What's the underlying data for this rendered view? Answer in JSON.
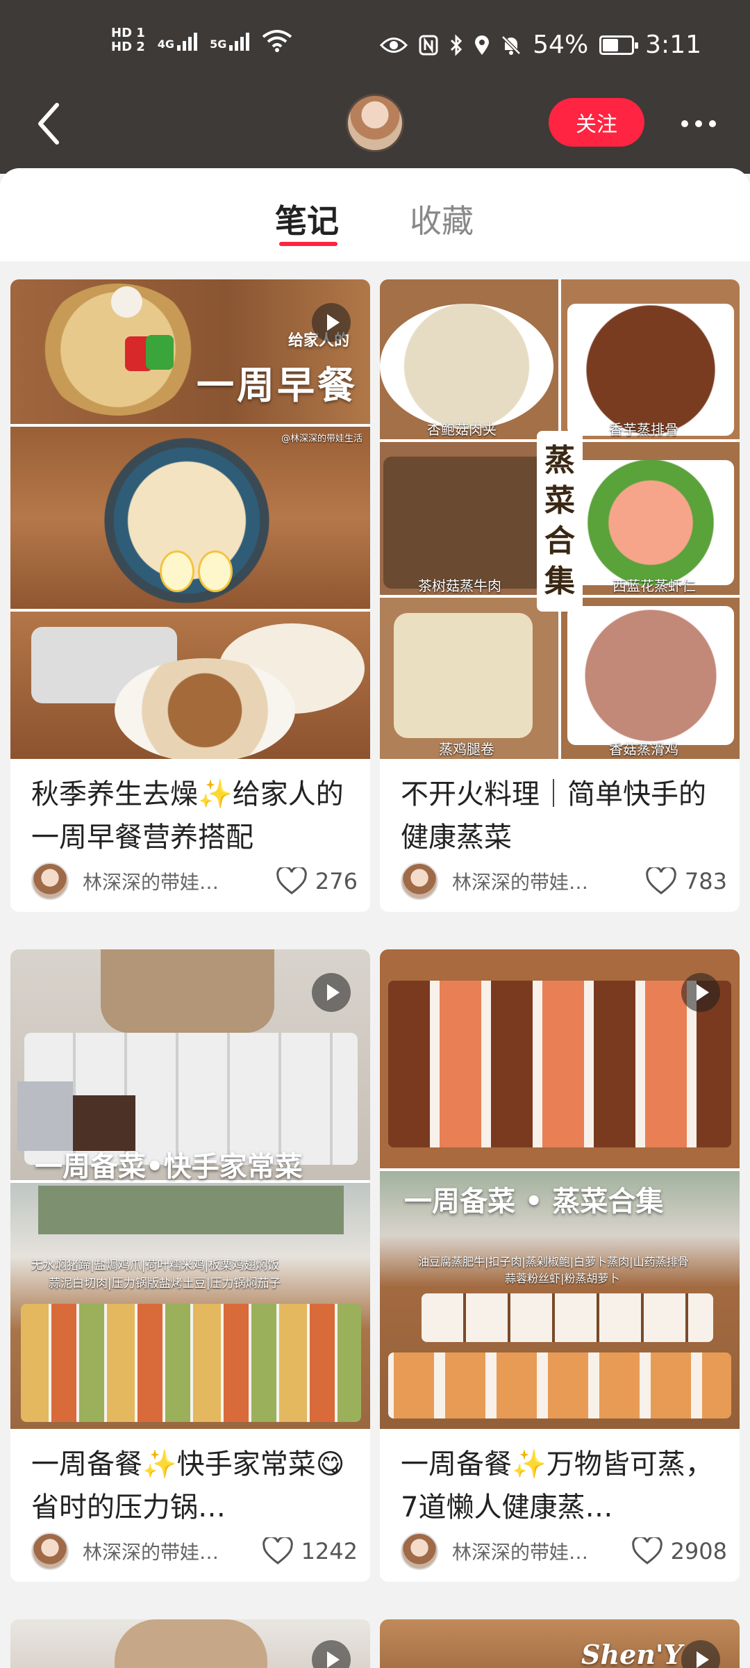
{
  "status": {
    "hd1": "HD 1",
    "hd2": "HD 2",
    "net1": "4G",
    "net2": "5G",
    "battery_text": "54%",
    "battery_level": 0.54,
    "time": "3:11"
  },
  "nav": {
    "follow_label": "关注"
  },
  "tabs": [
    {
      "label": "笔记",
      "active": true
    },
    {
      "label": "收藏",
      "active": false
    }
  ],
  "cards": [
    {
      "title": "秋季养生去燥✨给家人的一周早餐营养搭配",
      "author": "林深深的带娃…",
      "likes": "276",
      "cover_text": "一周早餐",
      "cover_sub": "给家人的",
      "watermark": "@林深深的带娃生活"
    },
    {
      "title": "不开火料理｜简单快手的健康蒸菜",
      "author": "林深深的带娃…",
      "likes": "783",
      "cover_text": "蒸菜合集",
      "labels": [
        "杏鲍菇肉夹",
        "香芋蒸排骨",
        "茶树菇蒸牛肉",
        "西蓝花蒸虾仁",
        "蒸鸡腿卷",
        "香菇蒸滑鸡"
      ]
    },
    {
      "title": "一周备餐✨快手家常菜😋省时的压力锅…",
      "author": "林深深的带娃…",
      "likes": "1242",
      "cover_text": "一周备菜•快手家常菜",
      "cover_sub1": "无水焖猪蹄|盐焗鸡爪|荷叶糯米鸡|板栗鸡翅焖饭",
      "cover_sub2": "蒜泥白切肉|压力锅版盐烤土豆|压力锅焖茄子"
    },
    {
      "title": "一周备餐✨万物皆可蒸，7道懒人健康蒸…",
      "author": "林深深的带娃…",
      "likes": "2908",
      "cover_text": "一周备菜 • 蒸菜合集",
      "cover_sub1": "油豆腐蒸肥牛|扣子肉|蒸剁椒鲍|白萝卜蒸肉|山药蒸排骨",
      "cover_sub2": "蒜蓉粉丝虾|粉蒸胡萝卜"
    }
  ],
  "partial_card_text": "Shen'Y"
}
